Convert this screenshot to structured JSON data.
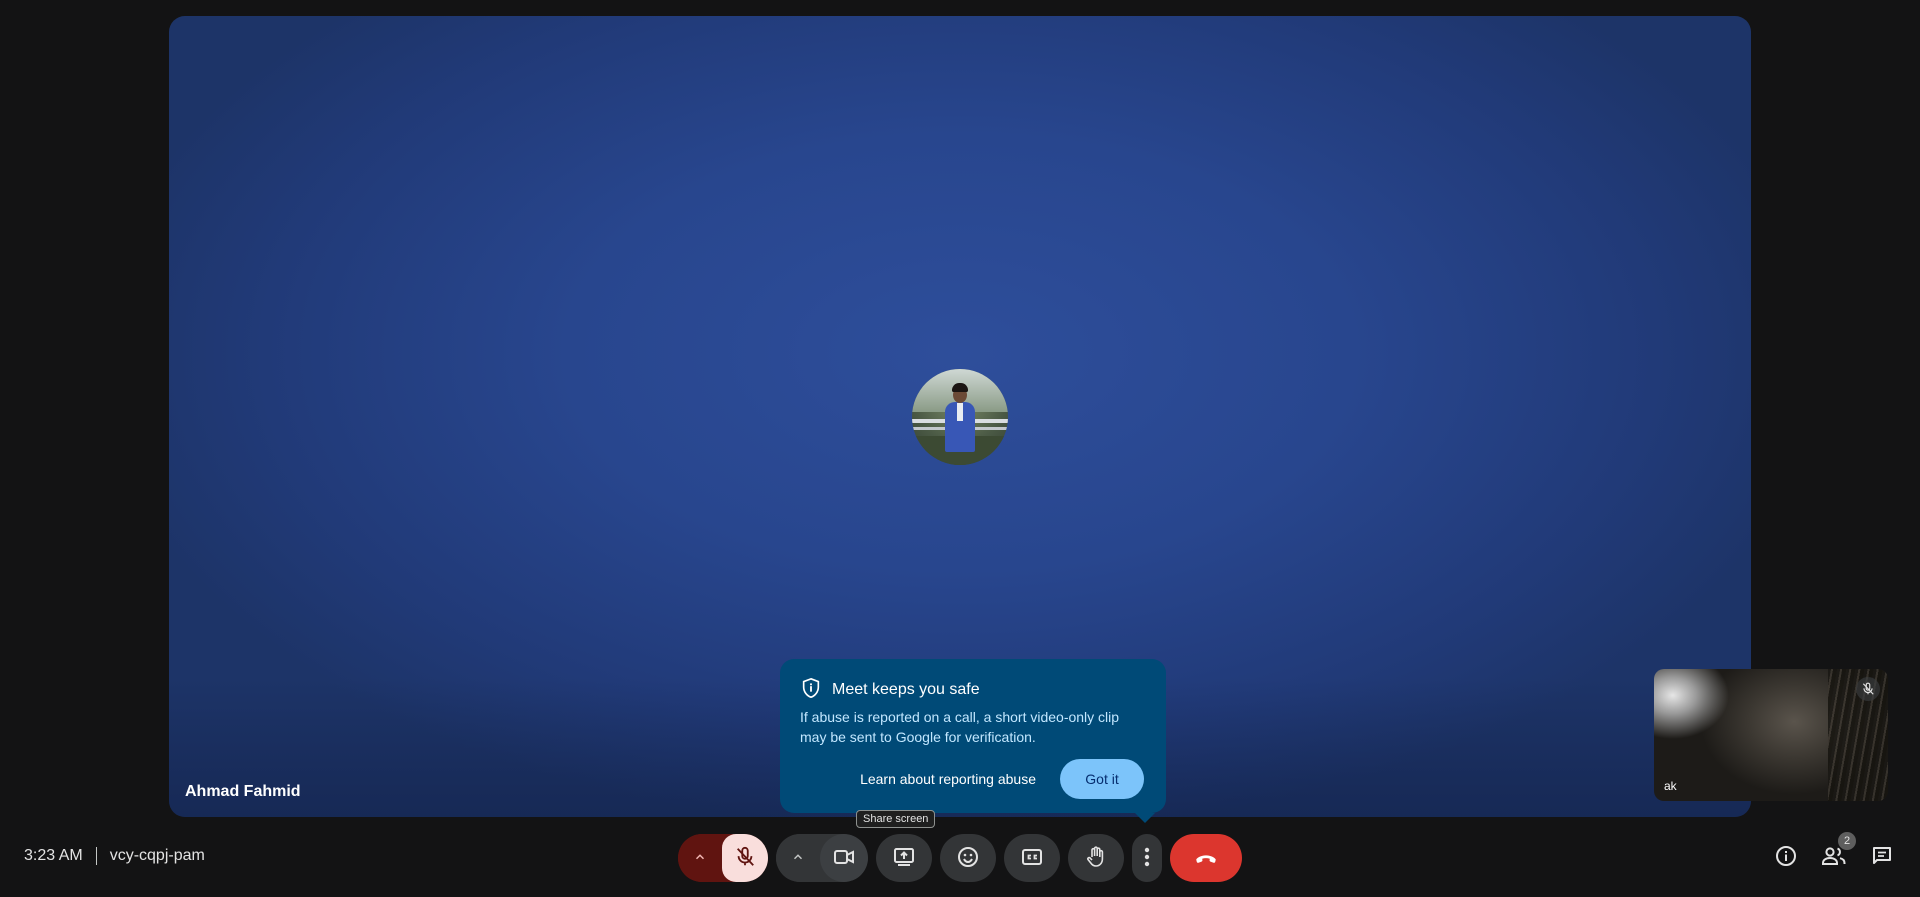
{
  "main_tile": {
    "participant_name": "Ahmad Fahmid"
  },
  "self_tile": {
    "name": "ak",
    "mic_muted": true
  },
  "popup": {
    "title": "Meet keeps you safe",
    "body": "If abuse is reported on a call, a short video-only clip may be sent to Google for verification.",
    "link_label": "Learn about reporting abuse",
    "confirm_label": "Got it"
  },
  "tooltip": {
    "text": "Share screen"
  },
  "meeting": {
    "time": "3:23 AM",
    "code": "vcy-cqpj-pam"
  },
  "toolbar": {
    "mic_state": "muted",
    "camera_state": "off",
    "icons": [
      "chevron-up-icon",
      "mic-off-icon",
      "chevron-up-icon",
      "videocam-off-icon",
      "present-screen-icon",
      "emoji-icon",
      "captions-icon",
      "raise-hand-icon",
      "more-vert-icon",
      "call-end-icon"
    ]
  },
  "right_panel": {
    "participants_count": "2",
    "icons": [
      "info-icon",
      "people-icon",
      "chat-icon"
    ]
  },
  "colors": {
    "end_call": "#dc362e",
    "mic_muted_bg": "#f9dedc",
    "popup_bg": "#004a77",
    "accent_button": "#7cc4fa"
  }
}
